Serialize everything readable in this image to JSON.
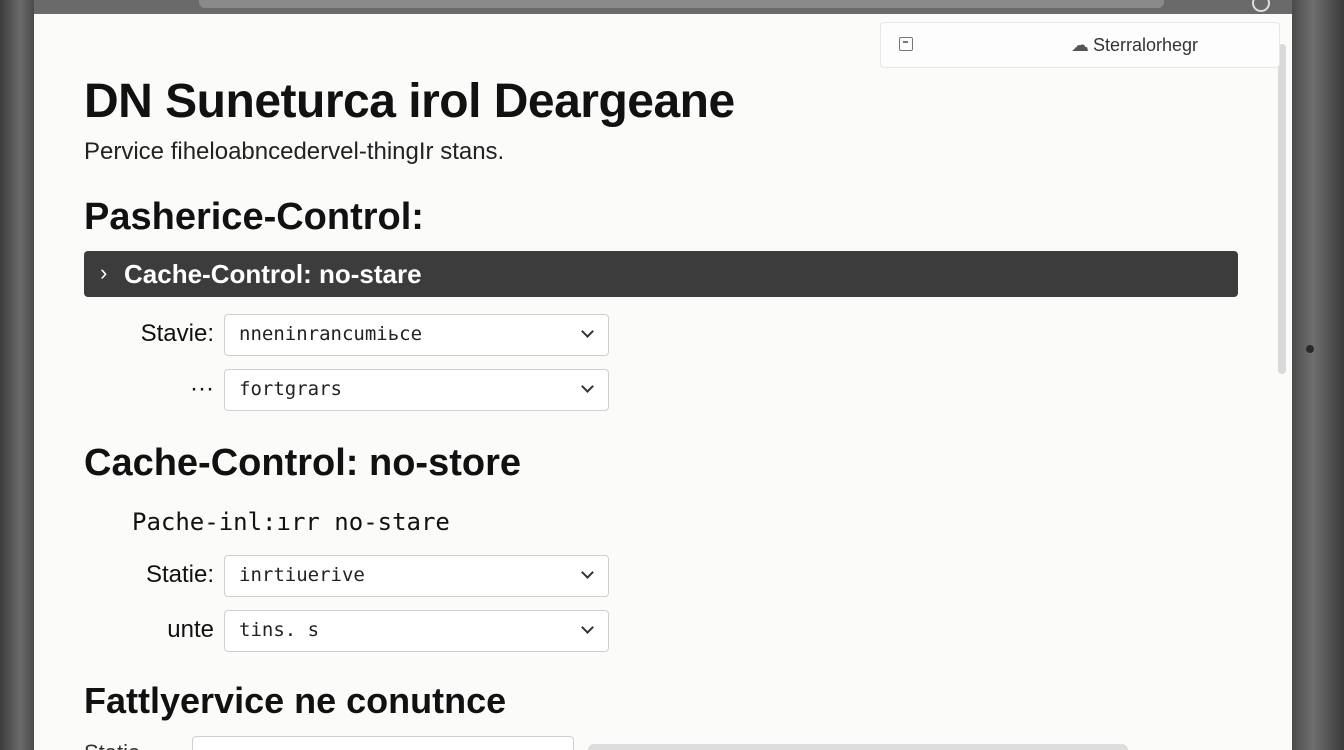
{
  "browser": {
    "settings_label": "Sterralorhegr"
  },
  "page": {
    "title": "DN Suneturca irol Deargeane",
    "subtitle": "Pervice fiheloabncedervel-thingIr stans."
  },
  "sections": {
    "s1": {
      "heading": "Pasherice-Control:",
      "banner": "Cache-Control: no-stare",
      "fields": [
        {
          "label": "Stavie:",
          "value": "nneninrancumiьce"
        },
        {
          "label": "···",
          "value": "fortgrars"
        }
      ]
    },
    "s2": {
      "heading": "Cache-Control: no-store",
      "line": "Pache-inl:ırr no-stare",
      "fields": [
        {
          "label": "Statie:",
          "value": "inrtiuerive"
        },
        {
          "label": "unte",
          "value": "tins. s"
        }
      ]
    },
    "s3": {
      "heading": "Fattlyervice ne conutnce",
      "field_label": "Statie"
    }
  },
  "icons": {
    "doc": "document-icon",
    "settings": "cloud-settings-icon",
    "banner_chevron": "chevron-right-icon",
    "select_chevron": "chevron-down-icon"
  },
  "colors": {
    "page_bg": "#fbfbfa",
    "banner_bg": "#3c3c3c",
    "banner_text": "#ffffff",
    "bezel": "#5a5a5a"
  }
}
